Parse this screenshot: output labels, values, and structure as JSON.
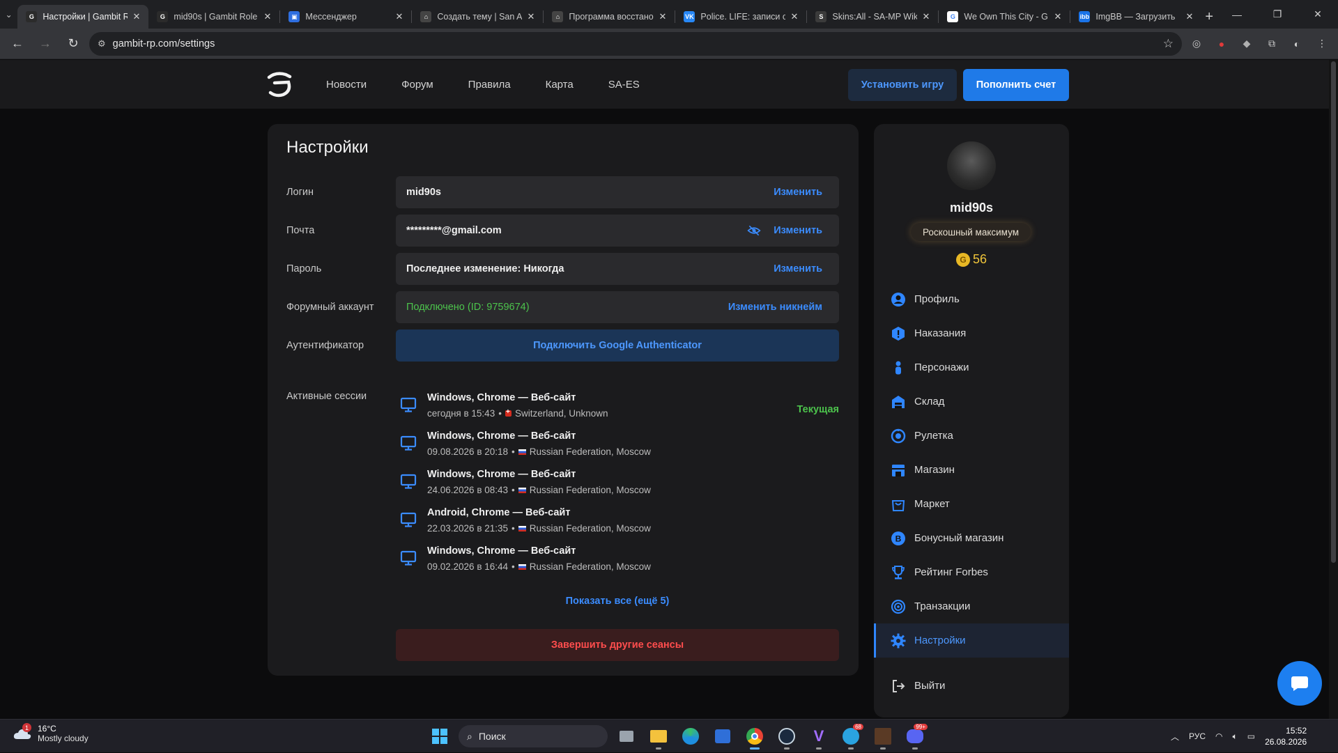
{
  "browser": {
    "tabs": [
      {
        "title": "Настройки | Gambit R",
        "favicon_color": "#2b2b2b",
        "favicon_text": "G",
        "active": true
      },
      {
        "title": "mid90s | Gambit Role",
        "favicon_color": "#2b2b2b",
        "favicon_text": "G",
        "active": false
      },
      {
        "title": "Мессенджер",
        "favicon_color": "#2f6fe0",
        "favicon_text": "▣",
        "active": false
      },
      {
        "title": "Создать тему | San A",
        "favicon_color": "#444444",
        "favicon_text": "⌂",
        "active": false
      },
      {
        "title": "Программа восстано",
        "favicon_color": "#444444",
        "favicon_text": "⌂",
        "active": false
      },
      {
        "title": "Police. LIFE: записи с",
        "favicon_color": "#2787f5",
        "favicon_text": "VK",
        "active": false
      },
      {
        "title": "Skins:All - SA-MP Wik",
        "favicon_color": "#3b3b3b",
        "favicon_text": "S",
        "active": false
      },
      {
        "title": "We Own This City - G",
        "favicon_color": "#ffffff",
        "favicon_text": "G",
        "active": false
      },
      {
        "title": "ImgBB — Загрузить",
        "favicon_color": "#1a73e8",
        "favicon_text": "ibb",
        "active": false
      }
    ],
    "new_tab_label": "+",
    "url": "gambit-rp.com/settings"
  },
  "site": {
    "nav": [
      "Новости",
      "Форум",
      "Правила",
      "Карта",
      "SA-ES"
    ],
    "install_button": "Установить игру",
    "topup_button": "Пополнить счет"
  },
  "settings": {
    "title": "Настройки",
    "rows": {
      "login": {
        "label": "Логин",
        "value": "mid90s",
        "action": "Изменить"
      },
      "email": {
        "label": "Почта",
        "value": "*********@gmail.com",
        "action": "Изменить"
      },
      "password": {
        "label": "Пароль",
        "value": "Последнее изменение: Никогда",
        "action": "Изменить"
      },
      "forum": {
        "label": "Форумный аккаунт",
        "value": "Подключено (ID: 9759674)",
        "action": "Изменить никнейм"
      },
      "authenticator": {
        "label": "Аутентификатор",
        "action": "Подключить Google Authenticator"
      }
    },
    "sessions_label": "Активные сессии",
    "sessions": [
      {
        "title": "Windows, Chrome — Веб-сайт",
        "time": "сегодня в 15:43",
        "location": "Switzerland, Unknown",
        "flag": "ch",
        "current": "Текущая"
      },
      {
        "title": "Windows, Chrome — Веб-сайт",
        "time": "09.08.2026 в 20:18",
        "location": "Russian Federation, Moscow",
        "flag": "ru",
        "current": ""
      },
      {
        "title": "Windows, Chrome — Веб-сайт",
        "time": "24.06.2026 в 08:43",
        "location": "Russian Federation, Moscow",
        "flag": "ru",
        "current": ""
      },
      {
        "title": "Android, Chrome — Веб-сайт",
        "time": "22.03.2026 в 21:35",
        "location": "Russian Federation, Moscow",
        "flag": "ru",
        "current": ""
      },
      {
        "title": "Windows, Chrome — Веб-сайт",
        "time": "09.02.2026 в 16:44",
        "location": "Russian Federation, Moscow",
        "flag": "ru",
        "current": ""
      }
    ],
    "show_all": "Показать все (ещё 5)",
    "end_sessions": "Завершить другие сеансы"
  },
  "profile": {
    "username": "mid90s",
    "rank": "Роскошный максимум",
    "coins": "56",
    "coin_symbol": "G",
    "menu": [
      {
        "label": "Профиль",
        "icon": "user-icon",
        "active": false
      },
      {
        "label": "Наказания",
        "icon": "warning-icon",
        "active": false
      },
      {
        "label": "Персонажи",
        "icon": "person-icon",
        "active": false
      },
      {
        "label": "Склад",
        "icon": "warehouse-icon",
        "active": false
      },
      {
        "label": "Рулетка",
        "icon": "roulette-icon",
        "active": false
      },
      {
        "label": "Магазин",
        "icon": "store-icon",
        "active": false
      },
      {
        "label": "Маркет",
        "icon": "bag-icon",
        "active": false
      },
      {
        "label": "Бонусный магазин",
        "icon": "bonus-icon",
        "active": false
      },
      {
        "label": "Рейтинг Forbes",
        "icon": "trophy-icon",
        "active": false
      },
      {
        "label": "Транзакции",
        "icon": "transactions-icon",
        "active": false
      },
      {
        "label": "Настройки",
        "icon": "gear-icon",
        "active": true
      }
    ],
    "logout": "Выйти"
  },
  "colors": {
    "accent": "#2f86ff",
    "success": "#4cc34c",
    "danger": "#ff4d4d"
  },
  "taskbar": {
    "weather_temp": "16°C",
    "weather_desc": "Mostly cloudy",
    "weather_badge": "1",
    "search_placeholder": "Поиск",
    "telegram_badge": "68",
    "discord_badge": "99+",
    "language": "РУС",
    "time": "15:52",
    "date": "26.08.2026"
  }
}
